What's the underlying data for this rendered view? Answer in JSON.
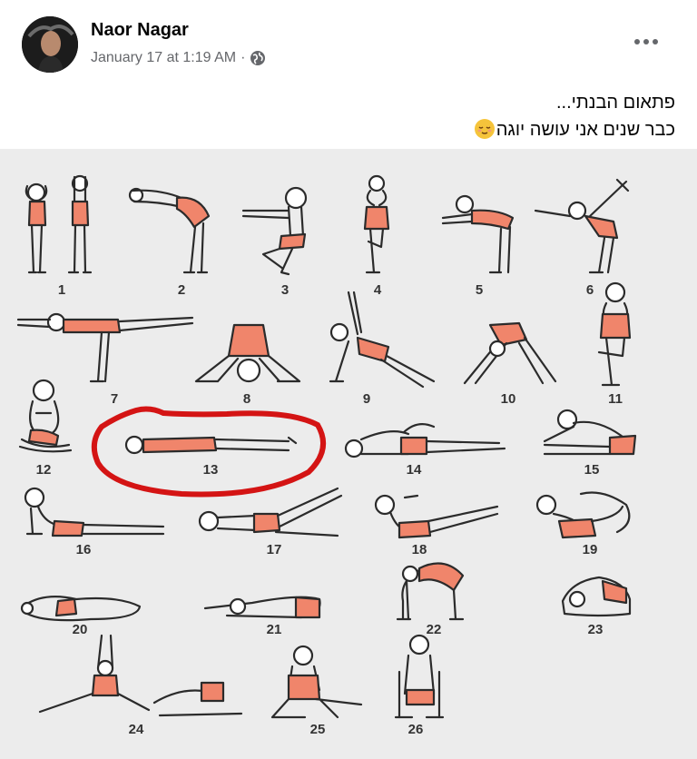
{
  "post": {
    "author_name": "Naor Nagar",
    "timestamp": "January 17 at 1:19 AM",
    "separator": "·",
    "privacy_icon": "globe-icon",
    "text_line_1": "פתאום הבנתי...",
    "text_line_2": "כבר שנים אני עושה יוגה",
    "text_emoji": "relieved-face-emoji"
  },
  "image": {
    "pose_numbers": [
      "1",
      "2",
      "3",
      "4",
      "5",
      "6",
      "7",
      "8",
      "9",
      "10",
      "11",
      "12",
      "13",
      "14",
      "15",
      "16",
      "17",
      "18",
      "19",
      "20",
      "21",
      "22",
      "23",
      "24",
      "25",
      "26"
    ],
    "highlighted_pose": "13",
    "colors": {
      "background": "#ececec",
      "body_fill": "#f0856b",
      "outline": "#2b2b2b",
      "circle": "#d41414"
    }
  }
}
